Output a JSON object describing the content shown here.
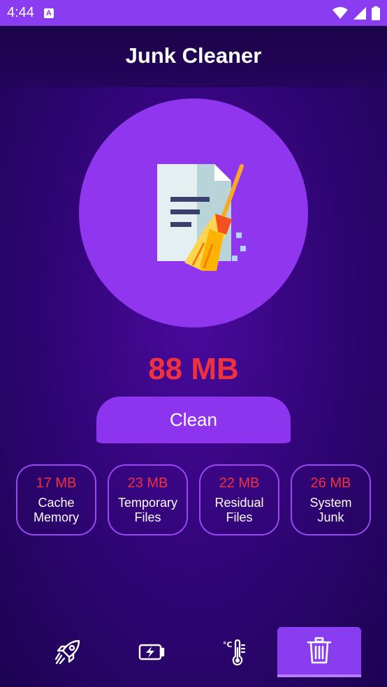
{
  "status_bar": {
    "time": "4:44",
    "notification_icon": "a-icon",
    "icons": [
      "wifi-icon",
      "signal-icon",
      "battery-icon"
    ]
  },
  "header": {
    "title": "Junk Cleaner"
  },
  "hero": {
    "icon": "document-broom-icon"
  },
  "summary": {
    "total_size": "88 MB"
  },
  "clean_button": {
    "label": "Clean"
  },
  "categories": [
    {
      "size": "17 MB",
      "label_line1": "Cache",
      "label_line2": "Memory"
    },
    {
      "size": "23 MB",
      "label_line1": "Temporary",
      "label_line2": "Files"
    },
    {
      "size": "22 MB",
      "label_line1": "Residual",
      "label_line2": "Files"
    },
    {
      "size": "26 MB",
      "label_line1": "System",
      "label_line2": "Junk"
    }
  ],
  "bottom_nav": {
    "items": [
      {
        "icon": "rocket-icon",
        "active": false
      },
      {
        "icon": "battery-charging-icon",
        "active": false
      },
      {
        "icon": "thermometer-icon",
        "active": false
      },
      {
        "icon": "trash-icon",
        "active": true
      }
    ]
  },
  "colors": {
    "status_bar": "#8a3df0",
    "accent_purple": "#9136ef",
    "size_red": "#f0323f",
    "background_dark": "#1c0352"
  }
}
